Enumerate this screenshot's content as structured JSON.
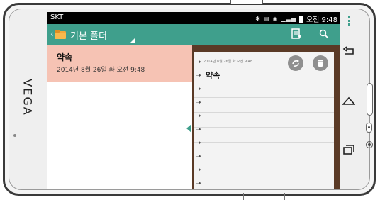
{
  "device": {
    "brand": "VEGA"
  },
  "statusbar": {
    "carrier": "SKT",
    "time": "오전 9:48",
    "icons": [
      "bluetooth-icon",
      "vibrate-icon",
      "wifi-icon",
      "signal-icon",
      "battery-icon"
    ]
  },
  "appbar": {
    "folder_title": "기본 폴더",
    "actions": [
      "new-note-icon",
      "search-icon"
    ]
  },
  "list": {
    "items": [
      {
        "title": "약속",
        "date": "2014년 8월 26일 화 오전 9:48"
      }
    ]
  },
  "note": {
    "date": "2014년 8월 26일 화 오전 9:48",
    "title": "약속",
    "actions": [
      "share-icon",
      "delete-icon"
    ]
  },
  "nav": {
    "buttons": [
      "back-icon",
      "home-icon",
      "recent-apps-icon"
    ]
  },
  "colors": {
    "accent": "#3f9f8c",
    "selection": "#f6c3b4",
    "notebook_frame": "#5a3a26"
  }
}
